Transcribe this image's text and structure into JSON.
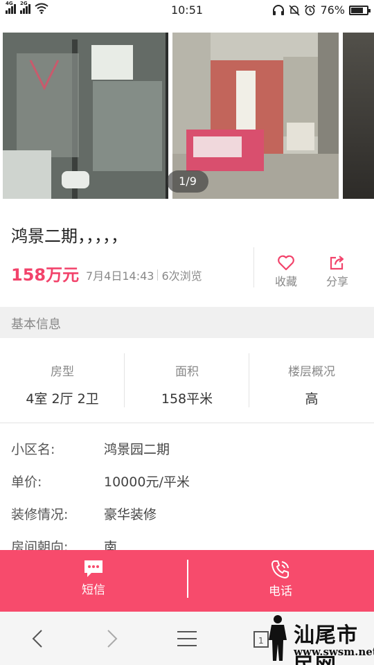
{
  "status_bar": {
    "network_left": "4G",
    "network_right": "2G",
    "time": "10:51",
    "battery": "76%",
    "battery_level": 0.76
  },
  "gallery": {
    "counter": "1/9",
    "photos": [
      "bathroom-photo",
      "bedroom-photo",
      "next-photo"
    ]
  },
  "listing": {
    "title": "鸿景二期，，，，，",
    "price": "158万元",
    "date": "7月4日14:43",
    "views": "6次浏览"
  },
  "actions": {
    "favorite": "收藏",
    "share": "分享"
  },
  "section": {
    "basic_info": "基本信息"
  },
  "stats": [
    {
      "label": "房型",
      "value": "4室 2厅 2卫"
    },
    {
      "label": "面积",
      "value": "158平米"
    },
    {
      "label": "楼层概况",
      "value": "高"
    }
  ],
  "details": [
    {
      "label": "小区名:",
      "value": "鸿景园二期"
    },
    {
      "label": "单价:",
      "value": "10000元/平米"
    },
    {
      "label": "装修情况:",
      "value": "豪华装修"
    },
    {
      "label": "房间朝向:",
      "value": "南"
    }
  ],
  "bottom_bar": {
    "sms": "短信",
    "phone": "电话"
  },
  "browser_nav": {
    "tabs_count": "1"
  },
  "watermark": {
    "name": "汕尾市民网",
    "url": "www.swsm.net"
  },
  "colors": {
    "accent": "#f74b6c",
    "price": "#f2436b"
  }
}
